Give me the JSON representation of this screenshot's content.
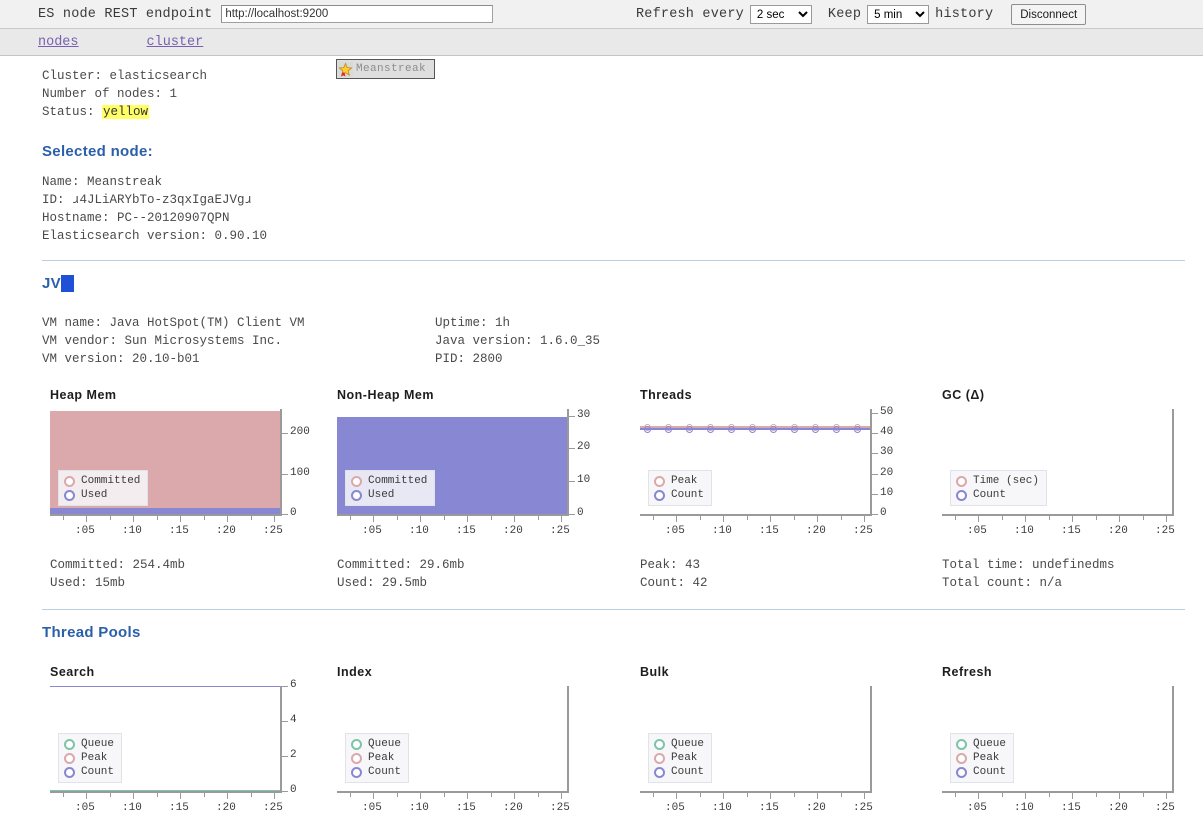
{
  "toolbar": {
    "endpoint_label": "ES node REST endpoint",
    "endpoint_value": "http://localhost:9200",
    "endpoint_placeholder": "http://localhost:9200",
    "refresh_label": "Refresh every",
    "refresh_value": "2 sec",
    "refresh_options": [
      "2 sec"
    ],
    "keep_label": "Keep",
    "keep_value": "5 min",
    "keep_options": [
      "5 min"
    ],
    "history_label": "history",
    "disconnect_label": "Disconnect"
  },
  "nav": {
    "items": [
      {
        "label": "nodes"
      },
      {
        "label": "cluster"
      }
    ]
  },
  "cluster": {
    "cluster_line": "Cluster: elasticsearch",
    "nodes_line": "Number of nodes: 1",
    "status_prefix": "Status: ",
    "status_value": "yellow",
    "status_color": "#ffff66",
    "node_button_label": "Meanstreak"
  },
  "selected_node": {
    "heading": "Selected node:",
    "name": "Name: Meanstreak",
    "id": "ID: ɹ4JLiARYbTo-z3qxIgaEJVgɹ",
    "hostname": "Hostname: PC--20120907QPN",
    "version": "Elasticsearch version: 0.90.10"
  },
  "jvm": {
    "heading": "JVM",
    "vm_name": "VM name: Java HotSpot(TM) Client VM",
    "vm_vendor": "VM vendor: Sun Microsystems Inc.",
    "vm_version": "VM version: 20.10-b01",
    "uptime": "Uptime: 1h",
    "java_version": "Java version: 1.6.0_35",
    "pid": "PID: 2800"
  },
  "thread_pools": {
    "heading": "Thread Pools"
  },
  "colors": {
    "committed_pink": "#dba8ab",
    "used_purple": "#8787d4",
    "queue_green": "#7fc3a8",
    "axis_gray": "#9a9a9a",
    "heading_blue": "#2b5faa",
    "link_purple": "#7a5fb0"
  },
  "chart_data": [
    {
      "id": "heap-mem",
      "type": "area",
      "title": "Heap Mem",
      "xlabel": "",
      "ylabel": "",
      "ylim": [
        0,
        260
      ],
      "yticks": [
        0,
        100,
        200
      ],
      "ytick_labels": [
        "0",
        "100",
        "200"
      ],
      "x": [
        ":05",
        ":10",
        ":15",
        ":20",
        ":25"
      ],
      "xticks": [
        ":05",
        ":10",
        ":15",
        ":20",
        ":25"
      ],
      "grid": false,
      "legend_position": "bottom-left",
      "series": [
        {
          "name": "Committed",
          "color": "#dba8ab",
          "value": 254.4,
          "values": [
            254.4,
            254.4,
            254.4,
            254.4,
            254.4
          ]
        },
        {
          "name": "Used",
          "color": "#8787d4",
          "value": 15,
          "values": [
            15,
            15,
            15,
            15,
            15
          ]
        }
      ],
      "stats": [
        "Committed: 254.4mb",
        "Used: 15mb"
      ]
    },
    {
      "id": "non-heap-mem",
      "type": "area",
      "title": "Non-Heap Mem",
      "xlabel": "",
      "ylabel": "",
      "ylim": [
        0,
        32
      ],
      "yticks": [
        0,
        10,
        20,
        30
      ],
      "ytick_labels": [
        "0",
        "10",
        "20",
        "30"
      ],
      "x": [
        ":05",
        ":10",
        ":15",
        ":20",
        ":25"
      ],
      "xticks": [
        ":05",
        ":10",
        ":15",
        ":20",
        ":25"
      ],
      "grid": false,
      "legend_position": "bottom-left",
      "series": [
        {
          "name": "Committed",
          "color": "#dba8ab",
          "value": 29.6,
          "values": [
            29.6,
            29.6,
            29.6,
            29.6,
            29.6
          ]
        },
        {
          "name": "Used",
          "color": "#8787d4",
          "value": 29.5,
          "values": [
            29.5,
            29.5,
            29.5,
            29.5,
            29.5
          ]
        }
      ],
      "stats": [
        "Committed: 29.6mb",
        "Used: 29.5mb"
      ]
    },
    {
      "id": "threads",
      "type": "line",
      "title": "Threads",
      "xlabel": "",
      "ylabel": "",
      "ylim": [
        0,
        52
      ],
      "yticks": [
        0,
        10,
        20,
        30,
        40,
        50
      ],
      "ytick_labels": [
        "0",
        "10",
        "20",
        "30",
        "40",
        "50"
      ],
      "x": [
        ":05",
        ":10",
        ":15",
        ":20",
        ":25"
      ],
      "xticks": [
        ":05",
        ":10",
        ":15",
        ":20",
        ":25"
      ],
      "grid": false,
      "legend_position": "bottom-left",
      "series": [
        {
          "name": "Peak",
          "color": "#dba8ab",
          "value": 43,
          "values": [
            43,
            43,
            43,
            43,
            43
          ]
        },
        {
          "name": "Count",
          "color": "#8787d4",
          "value": 42,
          "values": [
            42,
            42,
            42,
            42,
            42
          ]
        }
      ],
      "stats": [
        "Peak: 43",
        "Count: 42"
      ]
    },
    {
      "id": "gc",
      "type": "line",
      "title": "GC (Δ)",
      "xlabel": "",
      "ylabel": "",
      "ylim": [
        0,
        1
      ],
      "yticks": [],
      "ytick_labels": [],
      "x": [
        ":05",
        ":10",
        ":15",
        ":20",
        ":25"
      ],
      "xticks": [
        ":05",
        ":10",
        ":15",
        ":20",
        ":25"
      ],
      "grid": false,
      "legend_position": "bottom-left",
      "series": [
        {
          "name": "Time (sec)",
          "color": "#dba8ab",
          "value": null,
          "values": []
        },
        {
          "name": "Count",
          "color": "#8787d4",
          "value": null,
          "values": []
        }
      ],
      "stats": [
        "Total time: undefinedms",
        "Total count: n/a"
      ]
    },
    {
      "id": "pool-search",
      "type": "line",
      "title": "Search",
      "xlabel": "",
      "ylabel": "",
      "ylim": [
        0,
        6
      ],
      "yticks": [
        0,
        2,
        4,
        6
      ],
      "ytick_labels": [
        "0",
        "2",
        "4",
        "6"
      ],
      "x": [
        ":05",
        ":10",
        ":15",
        ":20",
        ":25"
      ],
      "xticks": [
        ":05",
        ":10",
        ":15",
        ":20",
        ":25"
      ],
      "grid": false,
      "legend_position": "bottom-left",
      "series": [
        {
          "name": "Queue",
          "color": "#7fc3a8",
          "value": 0,
          "values": [
            0,
            0,
            0,
            0,
            0
          ]
        },
        {
          "name": "Peak",
          "color": "#dba8ab",
          "value": 6,
          "values": [
            6,
            6,
            6,
            6,
            6
          ]
        },
        {
          "name": "Count",
          "color": "#8787d4",
          "value": 6,
          "values": [
            6,
            6,
            6,
            6,
            6
          ]
        }
      ],
      "stats": []
    },
    {
      "id": "pool-index",
      "type": "line",
      "title": "Index",
      "xlabel": "",
      "ylabel": "",
      "ylim": [
        0,
        1
      ],
      "yticks": [],
      "ytick_labels": [],
      "x": [
        ":05",
        ":10",
        ":15",
        ":20",
        ":25"
      ],
      "xticks": [
        ":05",
        ":10",
        ":15",
        ":20",
        ":25"
      ],
      "grid": false,
      "legend_position": "bottom-left",
      "series": [
        {
          "name": "Queue",
          "color": "#7fc3a8",
          "value": null,
          "values": []
        },
        {
          "name": "Peak",
          "color": "#dba8ab",
          "value": null,
          "values": []
        },
        {
          "name": "Count",
          "color": "#8787d4",
          "value": null,
          "values": []
        }
      ],
      "stats": []
    },
    {
      "id": "pool-bulk",
      "type": "line",
      "title": "Bulk",
      "xlabel": "",
      "ylabel": "",
      "ylim": [
        0,
        1
      ],
      "yticks": [],
      "ytick_labels": [],
      "x": [
        ":05",
        ":10",
        ":15",
        ":20",
        ":25"
      ],
      "xticks": [
        ":05",
        ":10",
        ":15",
        ":20",
        ":25"
      ],
      "grid": false,
      "legend_position": "bottom-left",
      "series": [
        {
          "name": "Queue",
          "color": "#7fc3a8",
          "value": null,
          "values": []
        },
        {
          "name": "Peak",
          "color": "#dba8ab",
          "value": null,
          "values": []
        },
        {
          "name": "Count",
          "color": "#8787d4",
          "value": null,
          "values": []
        }
      ],
      "stats": []
    },
    {
      "id": "pool-refresh",
      "type": "line",
      "title": "Refresh",
      "xlabel": "",
      "ylabel": "",
      "ylim": [
        0,
        1
      ],
      "yticks": [],
      "ytick_labels": [],
      "x": [
        ":05",
        ":10",
        ":15",
        ":20",
        ":25"
      ],
      "xticks": [
        ":05",
        ":10",
        ":15",
        ":20",
        ":25"
      ],
      "grid": false,
      "legend_position": "bottom-left",
      "series": [
        {
          "name": "Queue",
          "color": "#7fc3a8",
          "value": null,
          "values": []
        },
        {
          "name": "Peak",
          "color": "#dba8ab",
          "value": null,
          "values": []
        },
        {
          "name": "Count",
          "color": "#8787d4",
          "value": null,
          "values": []
        }
      ],
      "stats": []
    }
  ]
}
